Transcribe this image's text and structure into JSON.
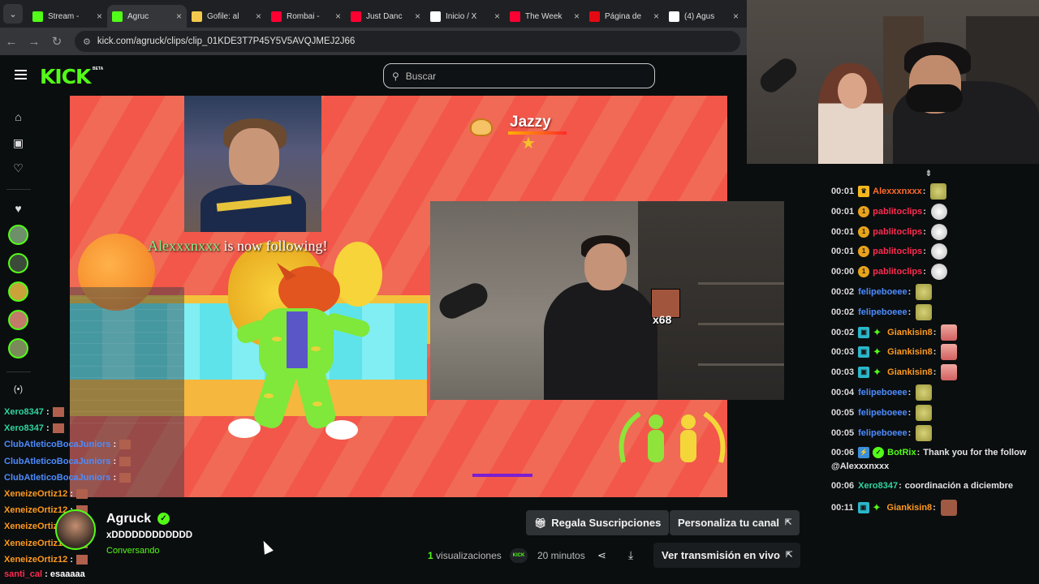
{
  "browser": {
    "tabs": [
      {
        "label": "Stream -",
        "icon": "kick-favicon",
        "color": "#53fc18"
      },
      {
        "label": "Agruc",
        "icon": "kick-favicon",
        "color": "#53fc18",
        "active": true
      },
      {
        "label": "Gofile: al",
        "icon": "gofile-favicon",
        "color": "#f2c94c"
      },
      {
        "label": "Rombai -",
        "icon": "youtube-favicon",
        "color": "#ff0033"
      },
      {
        "label": "Just Danc",
        "icon": "youtube-favicon",
        "color": "#ff0033"
      },
      {
        "label": "Inicio / X",
        "icon": "x-favicon",
        "color": "#ffffff"
      },
      {
        "label": "The Week",
        "icon": "youtube-favicon",
        "color": "#ff0033"
      },
      {
        "label": "Página de",
        "icon": "netflix-favicon",
        "color": "#e50914"
      },
      {
        "label": "(4) Agus",
        "icon": "x-favicon",
        "color": "#ffffff"
      }
    ],
    "url": "kick.com/agruck/clips/clip_01KDE3T7P45Y5V5AVQJMEJ2J66"
  },
  "header": {
    "logo": "KICK",
    "beta": "BETA",
    "search_placeholder": "Buscar"
  },
  "video": {
    "song_name": "Jazzy",
    "follow_user": "Alexxxnxxx",
    "follow_text": "is now following!",
    "emote_count": "x68"
  },
  "chat": [
    {
      "time": "00:01",
      "badges": [
        "crown"
      ],
      "user": "Alexxxnxxx",
      "color": "#ff6b2b",
      "emote": "em-c"
    },
    {
      "time": "00:01",
      "badges": [
        "one"
      ],
      "user": "pablitoclips",
      "color": "#ff2a4f",
      "emote": "em-w"
    },
    {
      "time": "00:01",
      "badges": [
        "one"
      ],
      "user": "pablitoclips",
      "color": "#ff2a4f",
      "emote": "em-w"
    },
    {
      "time": "00:01",
      "badges": [
        "one"
      ],
      "user": "pablitoclips",
      "color": "#ff2a4f",
      "emote": "em-w"
    },
    {
      "time": "00:00",
      "badges": [
        "one"
      ],
      "user": "pablitoclips",
      "color": "#ff2a4f",
      "emote": "em-w"
    },
    {
      "time": "00:02",
      "badges": [],
      "user": "felipeboeee",
      "color": "#4d8cff",
      "emote": "em-c"
    },
    {
      "time": "00:02",
      "badges": [],
      "user": "felipeboeee",
      "color": "#4d8cff",
      "emote": "em-c"
    },
    {
      "time": "00:02",
      "badges": [
        "tv",
        "dia"
      ],
      "user": "Giankisin8",
      "color": "#ff9a1f",
      "emote": "em-h"
    },
    {
      "time": "00:03",
      "badges": [
        "tv",
        "dia"
      ],
      "user": "Giankisin8",
      "color": "#ff9a1f",
      "emote": "em-h"
    },
    {
      "time": "00:03",
      "badges": [
        "tv",
        "dia"
      ],
      "user": "Giankisin8",
      "color": "#ff9a1f",
      "emote": "em-h"
    },
    {
      "time": "00:04",
      "badges": [],
      "user": "felipeboeee",
      "color": "#4d8cff",
      "emote": "em-c"
    },
    {
      "time": "00:05",
      "badges": [],
      "user": "felipeboeee",
      "color": "#4d8cff",
      "emote": "em-c"
    },
    {
      "time": "00:05",
      "badges": [],
      "user": "felipeboeee",
      "color": "#4d8cff",
      "emote": "em-c"
    }
  ],
  "chat_bot": {
    "time": "00:06",
    "user": "BotRix",
    "color": "#53fc18",
    "text": "Thank you for the follow",
    "mention": "@Alexxxnxxx"
  },
  "chat_xero": {
    "time": "00:06",
    "user": "Xero8347",
    "color": "#2fd5a0",
    "text": "coordinación a diciembre"
  },
  "chat_last": {
    "time": "00:11",
    "user": "Giankisin8",
    "color": "#ff9a1f"
  },
  "left_chat": [
    {
      "user": "Xero8347",
      "color": "#2fd5a0"
    },
    {
      "user": "Xero8347",
      "color": "#2fd5a0"
    },
    {
      "user": "ClubAtleticoBocaJuniors",
      "color": "#4d8cff"
    },
    {
      "user": "ClubAtleticoBocaJuniors",
      "color": "#4d8cff"
    },
    {
      "user": "ClubAtleticoBocaJuniors",
      "color": "#4d8cff"
    },
    {
      "user": "XeneizeOrtiz12",
      "color": "#ff9a1f"
    },
    {
      "user": "XeneizeOrtiz12",
      "color": "#ff9a1f"
    },
    {
      "user": "XeneizeOrtiz12",
      "color": "#ff9a1f"
    },
    {
      "user": "XeneizeOrtiz12",
      "color": "#ff9a1f"
    },
    {
      "user": "XeneizeOrtiz12",
      "color": "#ff9a1f"
    }
  ],
  "left_chat_last": {
    "user": "santi_cal",
    "color": "#ff2a4f",
    "text": "esaaaaa"
  },
  "channel": {
    "name": "Agruck",
    "title": "xDDDDDDDDDDDD",
    "category": "Conversando"
  },
  "actions": {
    "gift": "Regala Suscripciones",
    "customize": "Personaliza tu canal",
    "views_count": "1",
    "views_label": "visualizaciones",
    "duration": "20 minutos",
    "watch_live": "Ver transmisión en vivo"
  },
  "colors": {
    "brand": "#53fc18",
    "bg": "#0b0e0f"
  }
}
